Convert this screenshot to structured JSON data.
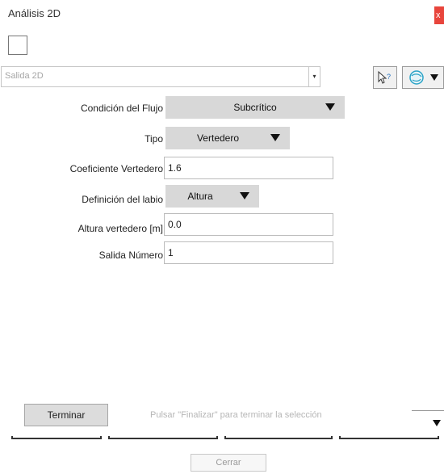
{
  "window": {
    "title": "Análisis 2D",
    "close_label": "x"
  },
  "top_bar": {
    "output_select_value": "Salida 2D",
    "output_select_arrow": "▾"
  },
  "form": {
    "flow_condition": {
      "label": "Condición del Flujo",
      "value": "Subcrítico"
    },
    "type": {
      "label": "Tipo",
      "value": "Vertedero"
    },
    "weir_coefficient": {
      "label": "Coeficiente Vertedero",
      "value": "1.6"
    },
    "lip_definition": {
      "label": "Definición del labio",
      "value": "Altura"
    },
    "weir_height": {
      "label": "Altura vertedero [m]",
      "value": "0.0"
    },
    "outlet_number": {
      "label": "Salida Número",
      "value": "1"
    }
  },
  "footer": {
    "finish_button": "Terminar",
    "hint": "Pulsar \"Finalizar\" para terminar la selección",
    "close_button": "Cerrar"
  },
  "icons": {
    "help_icon": "help-cursor-icon",
    "globe_icon": "globe-dropdown-icon",
    "accent_color": "#e8453c"
  }
}
